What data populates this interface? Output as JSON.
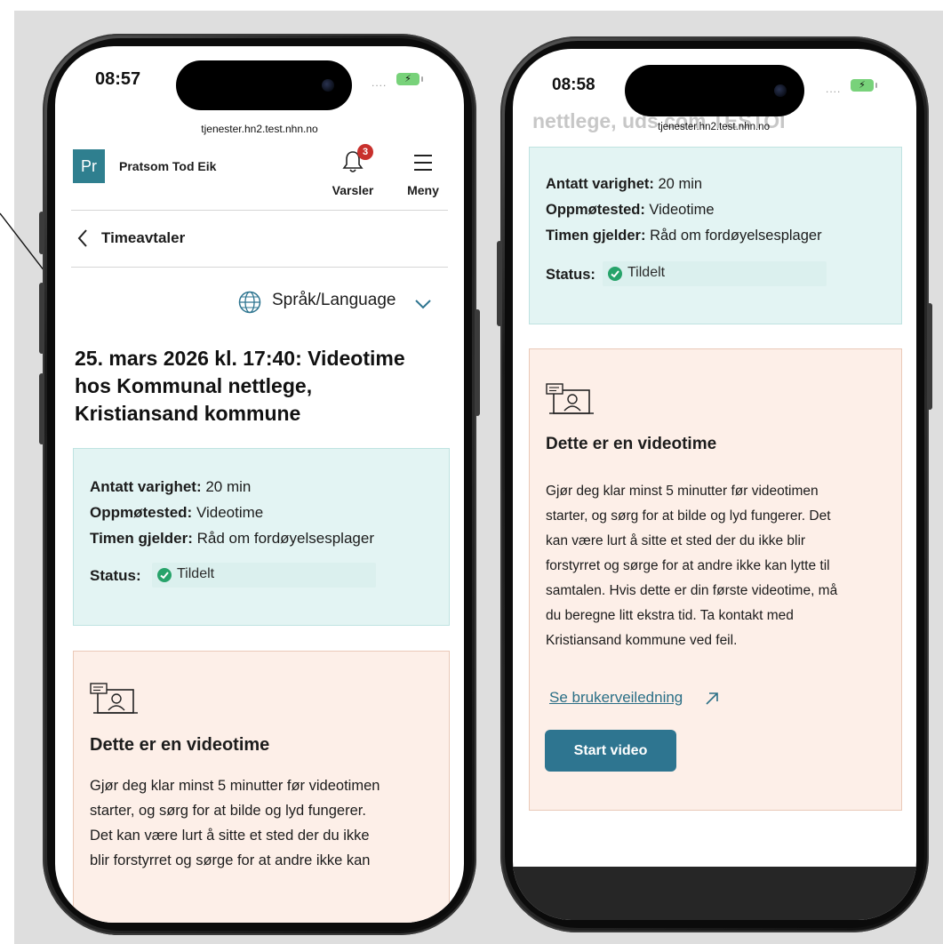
{
  "left_phone": {
    "status_bar": {
      "time": "08:57",
      "signal": "....",
      "battery_symbol": "⚡"
    },
    "url": "tjenester.hn2.test.nhn.no",
    "header": {
      "logo_initials": "Pr",
      "user_name": "Pratsom Tod Eik",
      "notifications_label": "Varsler",
      "notifications_count": "3",
      "menu_label": "Meny"
    },
    "breadcrumb": {
      "back_label": "Timeavtaler"
    },
    "language_selector": "Språk/Language",
    "appointment_title_lines": [
      "25. mars 2026 kl. 17:40: Videotime",
      "hos Kommunal nettlege,",
      "Kristiansand kommune"
    ],
    "details": {
      "duration_label": "Antatt varighet:",
      "duration_value": " 20 min",
      "location_label": "Oppmøtested:",
      "location_value": " Videotime",
      "subject_label": "Timen gjelder:",
      "subject_value": " Råd om fordøyelsesplager",
      "status_label": "Status:",
      "status_value": "Tildelt"
    },
    "video_info": {
      "title": "Dette er en videotime",
      "body_lines": [
        "Gjør deg klar minst 5 minutter før videotimen",
        "starter, og sørg for at bilde og lyd fungerer.",
        "Det kan være lurt å sitte et sted der du ikke",
        "blir forstyrret og sørge for at andre ikke kan"
      ]
    }
  },
  "right_phone": {
    "status_bar": {
      "time": "08:58",
      "signal": "....",
      "battery_symbol": "⚡"
    },
    "url": "tjenester.hn2.test.nhn.no",
    "scrolled_heading_fragment": "nettlege, uds com TESTOI",
    "details": {
      "duration_label": "Antatt varighet:",
      "duration_value": " 20 min",
      "location_label": "Oppmøtested:",
      "location_value": " Videotime",
      "subject_label": "Timen gjelder:",
      "subject_value": " Råd om fordøyelsesplager",
      "status_label": "Status:",
      "status_value": "Tildelt"
    },
    "video_info": {
      "title": "Dette er en videotime",
      "body_lines": [
        "Gjør deg klar minst 5 minutter før videotimen",
        "starter, og sørg for at bilde og lyd fungerer. Det",
        "kan være lurt å sitte et sted der du ikke blir",
        "forstyrret og sørge for at andre ikke kan lytte til",
        "samtalen. Hvis dette er din første videotime, må",
        "du beregne litt ekstra tid. Ta kontakt med",
        "Kristiansand kommune ved feil."
      ],
      "guide_link": "Se brukerveiledning",
      "start_button": "Start video"
    }
  },
  "colors": {
    "brand_teal": "#2f7f8f",
    "button_teal": "#2e7590",
    "info_bg": "#e3f4f3",
    "video_bg": "#fdefe8",
    "badge_red": "#c8302c",
    "status_green": "#27a36a"
  },
  "icons": [
    "globe-icon",
    "chevron-down-icon",
    "back-chevron-icon",
    "bell-icon",
    "hamburger-menu-icon",
    "video-consultation-icon",
    "external-link-arrow-icon",
    "check-circle-icon"
  ]
}
